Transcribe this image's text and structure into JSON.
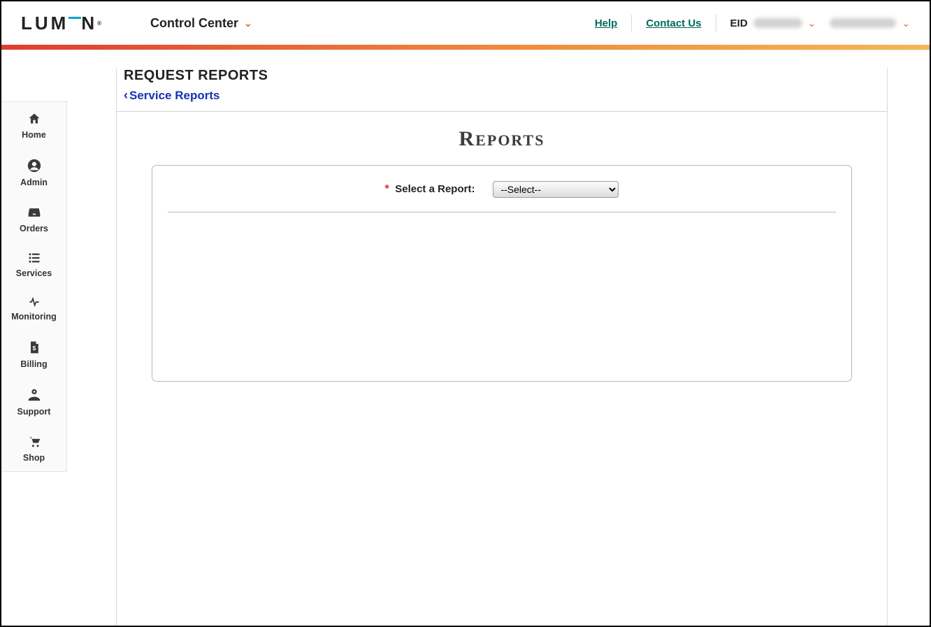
{
  "brand": {
    "name": "LUMEN"
  },
  "header": {
    "app_switch_label": "Control Center",
    "help_label": "Help",
    "contact_label": "Contact Us",
    "eid_label": "EID"
  },
  "sidebar": {
    "items": [
      {
        "key": "home",
        "label": "Home"
      },
      {
        "key": "admin",
        "label": "Admin"
      },
      {
        "key": "orders",
        "label": "Orders"
      },
      {
        "key": "services",
        "label": "Services"
      },
      {
        "key": "monitoring",
        "label": "Monitoring"
      },
      {
        "key": "billing",
        "label": "Billing"
      },
      {
        "key": "support",
        "label": "Support"
      },
      {
        "key": "shop",
        "label": "Shop"
      }
    ]
  },
  "page": {
    "title": "REQUEST REPORTS",
    "breadcrumb_label": "Service Reports",
    "section_heading_first": "R",
    "section_heading_rest": "EPORTS",
    "form": {
      "required_marker": "*",
      "select_label": "Select a Report:",
      "select_placeholder": "--Select--"
    }
  }
}
